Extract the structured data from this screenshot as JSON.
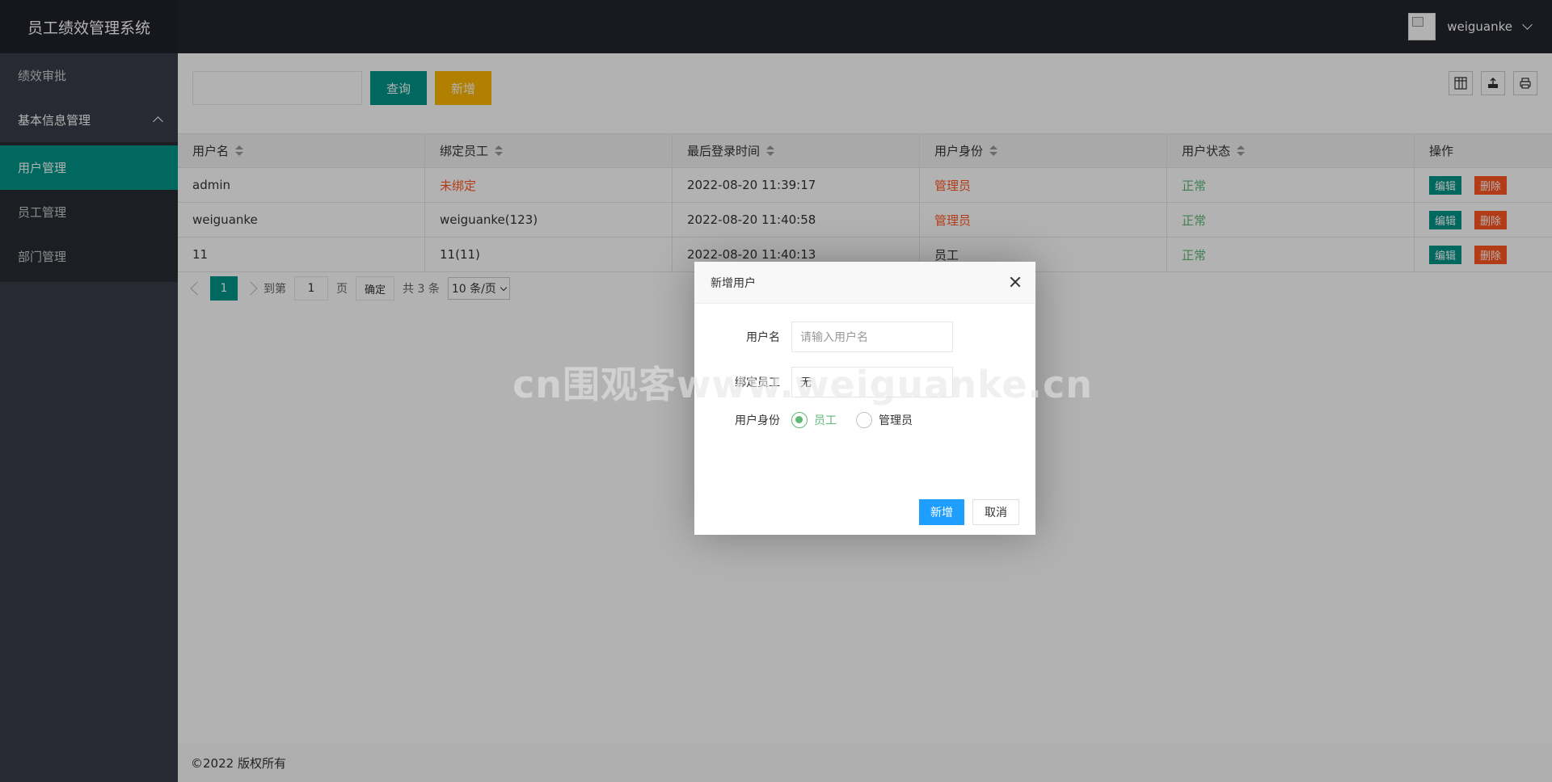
{
  "app_title": "员工绩效管理系统",
  "header": {
    "username": "weiguanke"
  },
  "sidebar": {
    "items": [
      {
        "label": "绩效审批"
      },
      {
        "label": "基本信息管理"
      }
    ],
    "subitems": [
      {
        "label": "用户管理",
        "active": true
      },
      {
        "label": "员工管理"
      },
      {
        "label": "部门管理"
      }
    ]
  },
  "toolbar": {
    "search_placeholder": "",
    "search_label": "查询",
    "add_label": "新增"
  },
  "table": {
    "headers": [
      "用户名",
      "绑定员工",
      "最后登录时间",
      "用户身份",
      "用户状态",
      "操作"
    ],
    "rows": [
      {
        "username": "admin",
        "employee": "未绑定",
        "last_login": "2022-08-20 11:39:17",
        "role": "管理员",
        "status": "正常"
      },
      {
        "username": "weiguanke",
        "employee": "weiguanke(123)",
        "last_login": "2022-08-20 11:40:58",
        "role": "管理员",
        "status": "正常"
      },
      {
        "username": "11",
        "employee": "11(11)",
        "last_login": "2022-08-20 11:40:13",
        "role": "员工",
        "status": "正常"
      }
    ],
    "edit_label": "编辑",
    "delete_label": "删除"
  },
  "pager": {
    "current": "1",
    "goto_label": "到第",
    "goto_value": "1",
    "page_label": "页",
    "confirm_label": "确定",
    "total_label": "共 3 条",
    "per_page": "10 条/页"
  },
  "footer": {
    "copyright": "©2022 版权所有"
  },
  "dialog": {
    "title": "新增用户",
    "username_label": "用户名",
    "username_placeholder": "请输入用户名",
    "employee_label": "绑定员工",
    "employee_value": "无",
    "role_label": "用户身份",
    "role_options": [
      "员工",
      "管理员"
    ],
    "role_selected": "员工",
    "submit_label": "新增",
    "cancel_label": "取消"
  },
  "watermark": "cn围观客www.weiguanke.cn",
  "colors": {
    "accent": "#009688",
    "warning": "#ffb800",
    "danger": "#ff5722",
    "ok": "#5fb878",
    "primary": "#1e9fff"
  }
}
